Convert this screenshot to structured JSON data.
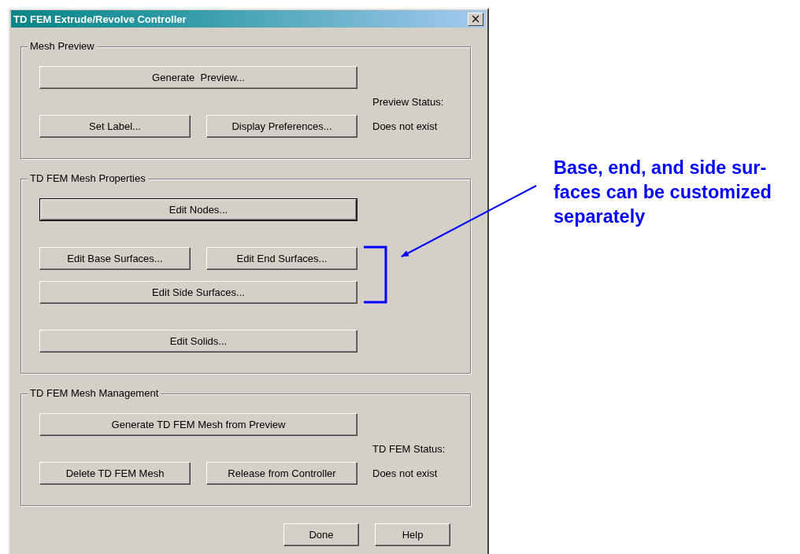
{
  "window": {
    "title": "TD FEM Extrude/Revolve Controller",
    "close": "×"
  },
  "groups": [
    {
      "title": "Mesh Preview",
      "clusters": [
        [
          {
            "buttons": [
              {
                "label": "Generate  Preview...",
                "default": false
              }
            ]
          }
        ],
        [
          {
            "buttons": [
              {
                "label": "Set Label...",
                "default": false
              },
              {
                "label": "Display Preferences...",
                "default": false
              }
            ]
          }
        ]
      ],
      "status_label": "Preview Status:",
      "status_value": "Does not exist"
    },
    {
      "title": "TD FEM Mesh Properties",
      "clusters": [
        [
          {
            "buttons": [
              {
                "label": "Edit Nodes...",
                "default": true
              }
            ]
          }
        ],
        [
          {
            "buttons": [
              {
                "label": "Edit Base Surfaces...",
                "default": false
              },
              {
                "label": "Edit End Surfaces...",
                "default": false
              }
            ]
          },
          {
            "buttons": [
              {
                "label": "Edit Side Surfaces...",
                "default": false
              }
            ]
          }
        ],
        [
          {
            "buttons": [
              {
                "label": "Edit Solids...",
                "default": false
              }
            ]
          }
        ]
      ]
    },
    {
      "title": "TD FEM Mesh Management",
      "clusters": [
        [
          {
            "buttons": [
              {
                "label": "Generate TD FEM Mesh from Preview",
                "default": false
              }
            ]
          }
        ],
        [
          {
            "buttons": [
              {
                "label": "Delete TD FEM Mesh",
                "default": false
              },
              {
                "label": "Release from Controller",
                "default": false
              }
            ]
          }
        ]
      ],
      "status_label": "TD FEM Status:",
      "status_value": "Does not exist"
    }
  ],
  "footer_buttons": [
    {
      "label": "Done",
      "default": false
    },
    {
      "label": "Help",
      "default": false
    }
  ],
  "annotation": "Base, end, and side sur-faces can be customized separately"
}
